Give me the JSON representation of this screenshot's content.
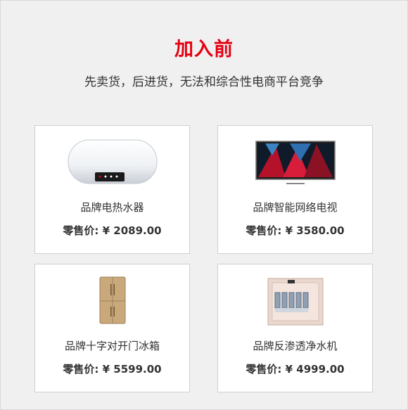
{
  "heading": {
    "title": "加入前",
    "subtitle": "先卖货，后进货，无法和综合性电商平台竞争"
  },
  "colors": {
    "accent": "#e60012",
    "card_border": "#cfcfcf",
    "background": "#f0f0f0"
  },
  "products": [
    {
      "name": "品牌电热水器",
      "price": "零售价: ¥ 2089.00",
      "icon": "water-heater-image"
    },
    {
      "name": "品牌智能网络电视",
      "price": "零售价: ¥ 3580.00",
      "icon": "smart-tv-image"
    },
    {
      "name": "品牌十字对开门冰箱",
      "price": "零售价: ¥ 5599.00",
      "icon": "refrigerator-image"
    },
    {
      "name": "品牌反渗透净水机",
      "price": "零售价: ¥ 4999.00",
      "icon": "water-purifier-image"
    }
  ]
}
